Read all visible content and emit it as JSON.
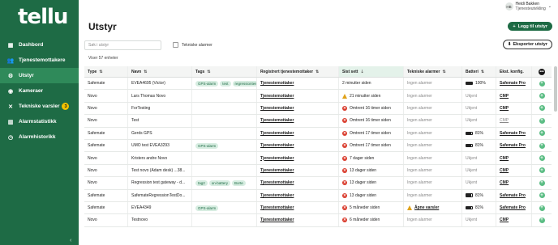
{
  "app": {
    "logo": "tellu"
  },
  "sidebar": {
    "items": [
      {
        "label": "Dashbord",
        "icon": "dashboard-icon",
        "glyph": "▦",
        "active": false
      },
      {
        "label": "Tjenestemottakere",
        "icon": "users-icon",
        "glyph": "👥",
        "active": false
      },
      {
        "label": "Utstyr",
        "icon": "device-icon",
        "glyph": "⚙",
        "active": true
      },
      {
        "label": "Kameraer",
        "icon": "camera-icon",
        "glyph": "◉",
        "active": false
      },
      {
        "label": "Tekniske varsler",
        "icon": "wrench-icon",
        "glyph": "✕",
        "active": false,
        "badge": "3"
      },
      {
        "label": "Alarmstatistikk",
        "icon": "chart-icon",
        "glyph": "▥",
        "active": false
      },
      {
        "label": "Alarmhistorikk",
        "icon": "history-icon",
        "glyph": "◷",
        "active": false
      }
    ],
    "collapse_glyph": "‹"
  },
  "header": {
    "title": "Utstyr",
    "user_initials": "HB",
    "user_name": "Heidi Bakken",
    "user_role": "Tjenesteutvikling",
    "add_label": "Legg til utstyr"
  },
  "toolbar": {
    "search_placeholder": "Søk i utstyr",
    "tech_alarms_label": "Tekniske alarmer",
    "export_label": "Eksporter utstyr",
    "showing_text": "Viser 57 enheter"
  },
  "table": {
    "headers": {
      "type": "Type",
      "name": "Navn",
      "tags": "Tags",
      "registered": "Registrert tjenestemottaker",
      "last_seen": "Sist sett",
      "tech_alarms": "Tekniske alarmer",
      "battery": "Batteri",
      "config": "Ekst. konfig."
    },
    "rows": [
      {
        "type": "Safemate",
        "name": "EVEA4695 (Victor)",
        "tags": [
          "GPS-alarm",
          "test",
          "regressiontest"
        ],
        "registered": "Tjenestemottaker",
        "seen": "2 minutter siden",
        "seen_status": "ok",
        "alarm": "Ingen alarmer",
        "alarm_status": "none",
        "battery": "100%",
        "battery_level": 1.0,
        "config": "Safemate Pro",
        "config_muted": false
      },
      {
        "type": "Novo",
        "name": "Lars Thomas Novo",
        "tags": [],
        "registered": "Tjenestemottaker",
        "seen": "21 minutter siden",
        "seen_status": "warn",
        "alarm": "Ingen alarmer",
        "alarm_status": "none",
        "battery": "Ukjent",
        "battery_level": null,
        "config": "CMP",
        "config_muted": false
      },
      {
        "type": "Novo",
        "name": "ForTesting",
        "tags": [],
        "registered": "Tjenestemottaker",
        "seen": "Omtrent 16 timer siden",
        "seen_status": "err",
        "alarm": "Ingen alarmer",
        "alarm_status": "none",
        "battery": "Ukjent",
        "battery_level": null,
        "config": "CMP",
        "config_muted": false
      },
      {
        "type": "Novo",
        "name": "Test",
        "tags": [],
        "registered": "Tjenestemottaker",
        "seen": "Omtrent 16 timer siden",
        "seen_status": "err",
        "alarm": "Ingen alarmer",
        "alarm_status": "none",
        "battery": "Ukjent",
        "battery_level": null,
        "config": "CMP",
        "config_muted": true
      },
      {
        "type": "Safemate",
        "name": "Gerds GPS",
        "tags": [],
        "registered": "Tjenestemottaker",
        "seen": "Omtrent 17 timer siden",
        "seen_status": "err",
        "alarm": "Ingen alarmer",
        "alarm_status": "none",
        "battery": "81%",
        "battery_level": 0.81,
        "config": "Safemate Pro",
        "config_muted": false
      },
      {
        "type": "Safemate",
        "name": "UMO test EVEA3293",
        "tags": [
          "GPS-alarm"
        ],
        "registered": "Tjenestemottaker",
        "seen": "Omtrent 17 timer siden",
        "seen_status": "err",
        "alarm": "Ingen alarmer",
        "alarm_status": "none",
        "battery": "81%",
        "battery_level": 0.81,
        "config": "Safemate Pro",
        "config_muted": false
      },
      {
        "type": "Novo",
        "name": "Kristers andre Novo",
        "tags": [],
        "registered": "Tjenestemottaker",
        "seen": "7 dager siden",
        "seen_status": "err",
        "alarm": "Ingen alarmer",
        "alarm_status": "none",
        "battery": "Ukjent",
        "battery_level": null,
        "config": "CMP",
        "config_muted": false
      },
      {
        "type": "Novo",
        "name": "Test novo (Adam desk) ...38...",
        "tags": [],
        "registered": "Tjenestemottaker",
        "seen": "13 dager siden",
        "seen_status": "err",
        "alarm": "Ingen alarmer",
        "alarm_status": "none",
        "battery": "Ukjent",
        "battery_level": null,
        "config": "CMP",
        "config_muted": false
      },
      {
        "type": "Novo",
        "name": "Regression test gateway - d...",
        "tags": [
          "tag2",
          "on-battery",
          "Borte"
        ],
        "registered": "Tjenestemottaker",
        "seen": "13 dager siden",
        "seen_status": "err",
        "alarm": "Ingen alarmer",
        "alarm_status": "none",
        "battery": "Ukjent",
        "battery_level": null,
        "config": "CMP",
        "config_muted": false
      },
      {
        "type": "Safemate",
        "name": "SafemateRegressionTestDo...",
        "tags": [],
        "registered": "Tjenestemottaker",
        "seen": "13 dager siden",
        "seen_status": "err",
        "alarm": "Ingen alarmer",
        "alarm_status": "none",
        "battery": "81%",
        "battery_level": 0.81,
        "config": "Safemate Pro",
        "config_muted": false
      },
      {
        "type": "Safemate",
        "name": "EVEA4349",
        "tags": [
          "GPS-alarm"
        ],
        "registered": "Tjenestemottaker",
        "seen": "5 måneder siden",
        "seen_status": "err",
        "alarm": "Åpne varsler",
        "alarm_status": "warn",
        "battery": "81%",
        "battery_level": 0.81,
        "config": "Safemate Pro",
        "config_muted": false
      },
      {
        "type": "Novo",
        "name": "Testnovo",
        "tags": [],
        "registered": "Tjenestemottaker",
        "seen": "6 måneder siden",
        "seen_status": "err",
        "alarm": "Ingen alarmer",
        "alarm_status": "none",
        "battery": "Ukjent",
        "battery_level": null,
        "config": "CMP",
        "config_muted": false
      }
    ]
  },
  "colors": {
    "brand": "#1e6b45",
    "error": "#d93a2b",
    "warning": "#e0a21a",
    "tag_bg": "#d7ede1"
  }
}
